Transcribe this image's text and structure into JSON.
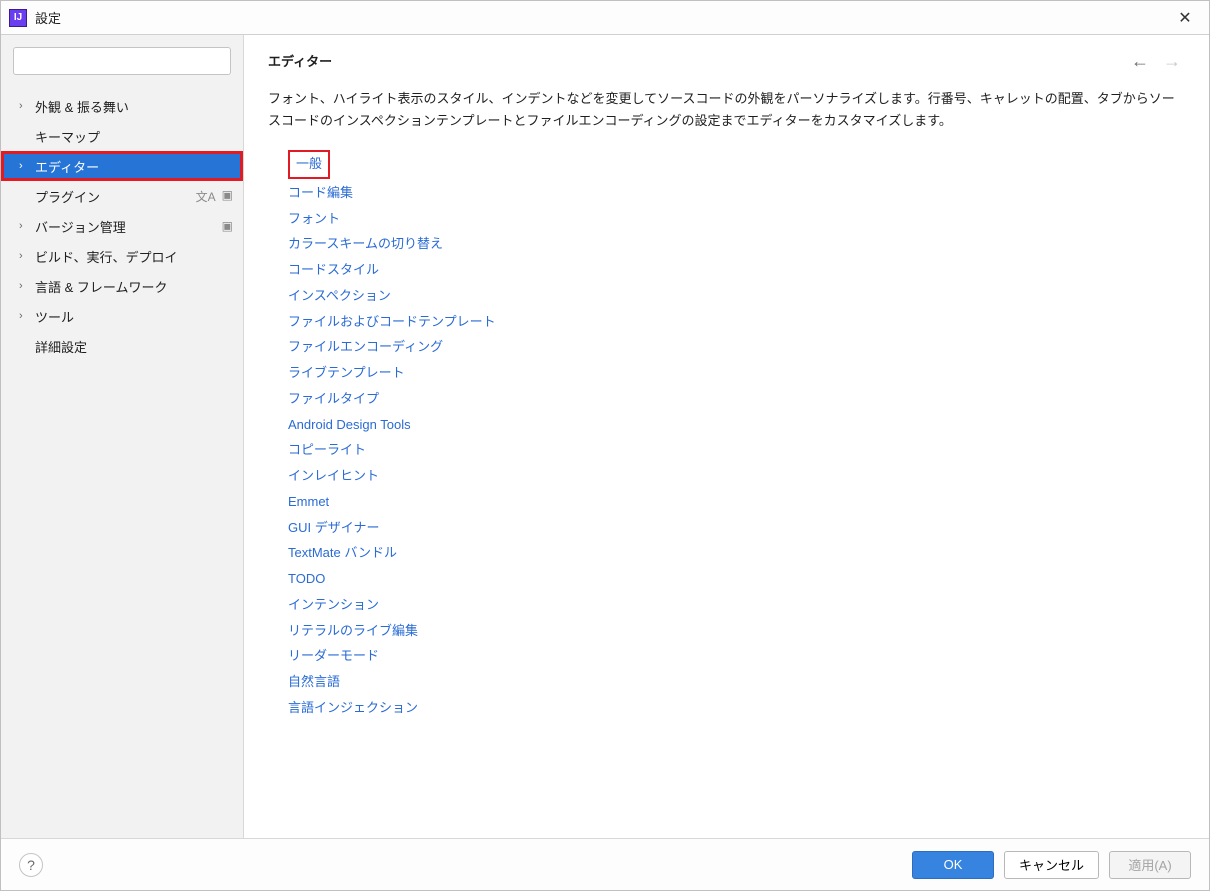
{
  "window": {
    "title": "設定",
    "appIconLetter": "IJ"
  },
  "sidebar": {
    "search_placeholder": "",
    "items": [
      {
        "label": "外観 & 振る舞い",
        "hasChildren": true,
        "selected": false,
        "badges": []
      },
      {
        "label": "キーマップ",
        "hasChildren": false,
        "selected": false,
        "badges": []
      },
      {
        "label": "エディター",
        "hasChildren": true,
        "selected": true,
        "badges": []
      },
      {
        "label": "プラグイン",
        "hasChildren": false,
        "selected": false,
        "badges": [
          "lang",
          "box"
        ]
      },
      {
        "label": "バージョン管理",
        "hasChildren": true,
        "selected": false,
        "badges": [
          "box"
        ]
      },
      {
        "label": "ビルド、実行、デプロイ",
        "hasChildren": true,
        "selected": false,
        "badges": []
      },
      {
        "label": "言語 & フレームワーク",
        "hasChildren": true,
        "selected": false,
        "badges": []
      },
      {
        "label": "ツール",
        "hasChildren": true,
        "selected": false,
        "badges": []
      },
      {
        "label": "詳細設定",
        "hasChildren": false,
        "selected": false,
        "badges": []
      }
    ]
  },
  "content": {
    "title": "エディター",
    "description": "フォント、ハイライト表示のスタイル、インデントなどを変更してソースコードの外観をパーソナライズします。行番号、キャレットの配置、タブからソースコードのインスペクションテンプレートとファイルエンコーディングの設定までエディターをカスタマイズします。",
    "links": [
      {
        "label": "一般",
        "highlighted": true
      },
      {
        "label": "コード編集"
      },
      {
        "label": "フォント"
      },
      {
        "label": "カラースキームの切り替え"
      },
      {
        "label": "コードスタイル"
      },
      {
        "label": "インスペクション"
      },
      {
        "label": "ファイルおよびコードテンプレート"
      },
      {
        "label": "ファイルエンコーディング"
      },
      {
        "label": "ライブテンプレート"
      },
      {
        "label": "ファイルタイプ"
      },
      {
        "label": "Android Design Tools"
      },
      {
        "label": "コピーライト"
      },
      {
        "label": "インレイヒント"
      },
      {
        "label": "Emmet"
      },
      {
        "label": "GUI デザイナー"
      },
      {
        "label": "TextMate バンドル"
      },
      {
        "label": "TODO"
      },
      {
        "label": "インテンション"
      },
      {
        "label": "リテラルのライブ編集"
      },
      {
        "label": "リーダーモード"
      },
      {
        "label": "自然言語"
      },
      {
        "label": "言語インジェクション"
      }
    ]
  },
  "footer": {
    "ok": "OK",
    "cancel": "キャンセル",
    "apply": "適用(A)"
  }
}
